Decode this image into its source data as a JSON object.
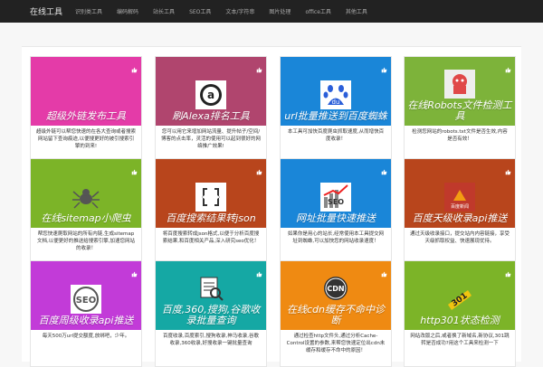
{
  "nav": {
    "brand": "在线工具",
    "items": [
      "识别类工具",
      "编码解码",
      "站长工具",
      "SEO工具",
      "文本/字符串",
      "图片处理",
      "office工具",
      "其他工具"
    ]
  },
  "cards": [
    {
      "title": "超级外链发布工具",
      "desc": "超级外链可以帮您快速的在各大查询或者搜索网站留下查询痕迹,以便搜更好的被引搜索引擎的到来!",
      "color": "#e43ba8",
      "icon": "none"
    },
    {
      "title": "刷Alexa排名工具",
      "desc": "您可以用它来增加网站流量、提升帖子/空间/博客的点击率，灵活的使用可以起到很好的网络推广效果!",
      "color": "#b0456e",
      "icon": "alexa-icon"
    },
    {
      "title": "url批量推送到百度蜘蛛",
      "desc": "本工具可加快百度爬虫抓取速度,从而增快百度收录！",
      "color": "#1a86d8",
      "icon": "baidu-paw-icon"
    },
    {
      "title": "在线Robots文件检测工具",
      "desc": "检测您网站的robots.txt文件是否生效,内容是否有效！",
      "color": "#7db33a",
      "icon": "robot-icon"
    },
    {
      "title": "在线sitemap小爬虫",
      "desc": "帮您快速爬取网站的所有内链,生成sitemap文档,以便更好的推送给搜索引擎,加速您网站的收录！",
      "color": "#7cb428",
      "icon": "spider-icon"
    },
    {
      "title": "百度搜索结果转json",
      "desc": "将百度搜索转成json格式,以便于分析百度搜索结果,和百度相关产品,深入研究seo优化！",
      "color": "#b8451c",
      "icon": "json-icon"
    },
    {
      "title": "网址批量快速推送",
      "desc": "如果你是用心的站长,经常使用本工具提交网址到蜘蛛,可以加快您的网站收录速度！",
      "color": "#1a86d8",
      "icon": "seo-chart-icon"
    },
    {
      "title": "百度天级收录api推送",
      "desc": "通过天级收录接口，提交站内内容链接，享受天级抓取权益、快速展现优待。",
      "color": "#b8451c",
      "icon": "baidu-news-icon"
    },
    {
      "title": "百度周级收录api推送",
      "desc": "每天500万url提交额度,放绑吧，少年。",
      "color": "#c23bd8",
      "icon": "seo-circle-icon"
    },
    {
      "title": "百度,360,搜狗,谷歌收录批量查询",
      "desc": "百度收录,百度索引,搜狗收录,神马收录,谷歌收录,360收录,好搜收录一键批量查询",
      "color": "#15a8a4",
      "icon": "search-doc-icon"
    },
    {
      "title": "在线cdn缓存不命中诊断",
      "desc": "通过检查http文件头,通过分析Cache-Control设置的参数,来帮您快速定位出cdn未缓存和缓存不命中的原因！",
      "color": "#ef8a12",
      "icon": "cdn-icon"
    },
    {
      "title": "http301状态检测",
      "desc": "网站改版之后,或者换了新域名,新协议,301跳转是否成功?用这个工具来检测一下",
      "color": "#7cb428",
      "icon": "301-sign-icon"
    }
  ]
}
